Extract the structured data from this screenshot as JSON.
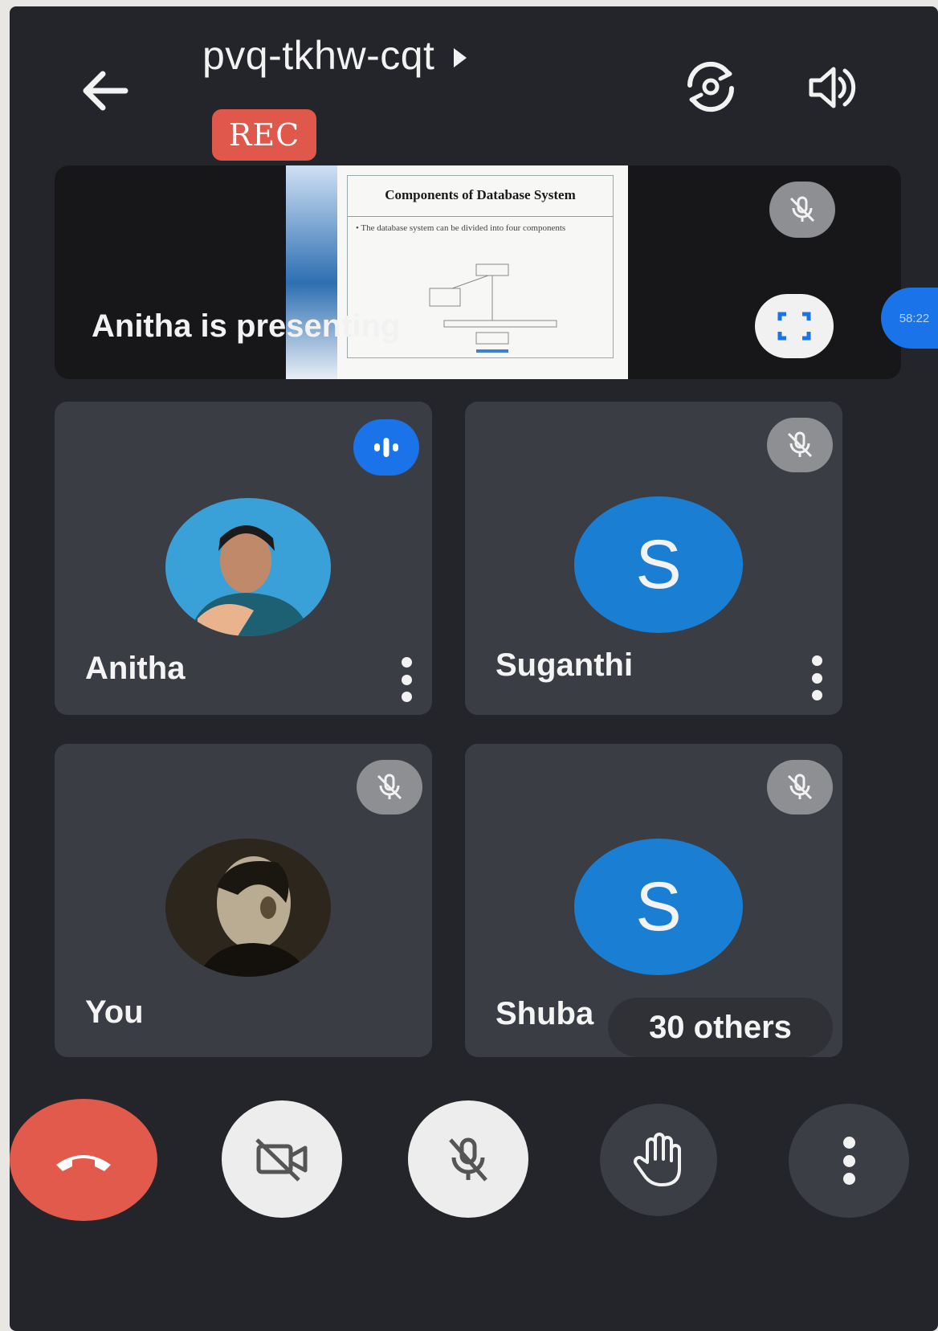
{
  "meeting": {
    "code": "pvq-tkhw-cqt",
    "recording_badge": "REC"
  },
  "presentation": {
    "label": "Anitha is presenting",
    "slide_title": "Components of Database System",
    "slide_text": "• The database system can be divided into four components",
    "timer": "58:22"
  },
  "participants": [
    {
      "name": "Anitha",
      "avatar": "photo",
      "status": "speaking"
    },
    {
      "name": "Suganthi",
      "avatar_letter": "S",
      "status": "muted"
    },
    {
      "name": "You",
      "avatar": "photo",
      "status": "muted"
    },
    {
      "name": "Shuba",
      "avatar_letter": "S",
      "status": "muted"
    }
  ],
  "overflow": {
    "label": "30 others"
  },
  "colors": {
    "background": "#24252b",
    "tile": "#3b3d44",
    "accent_blue": "#1a73e8",
    "end_call": "#e25a4c",
    "rec": "#e0574b"
  },
  "icons": {
    "back": "arrow-left-icon",
    "switch_camera": "switch-camera-icon",
    "speaker": "speaker-icon",
    "fullscreen": "fullscreen-icon",
    "muted": "mic-off-icon",
    "speaking": "audio-level-icon",
    "end_call": "phone-hangup-icon",
    "camera_off": "camera-off-icon",
    "mic_off": "mic-off-icon",
    "raise_hand": "hand-icon",
    "more": "more-vert-icon"
  }
}
